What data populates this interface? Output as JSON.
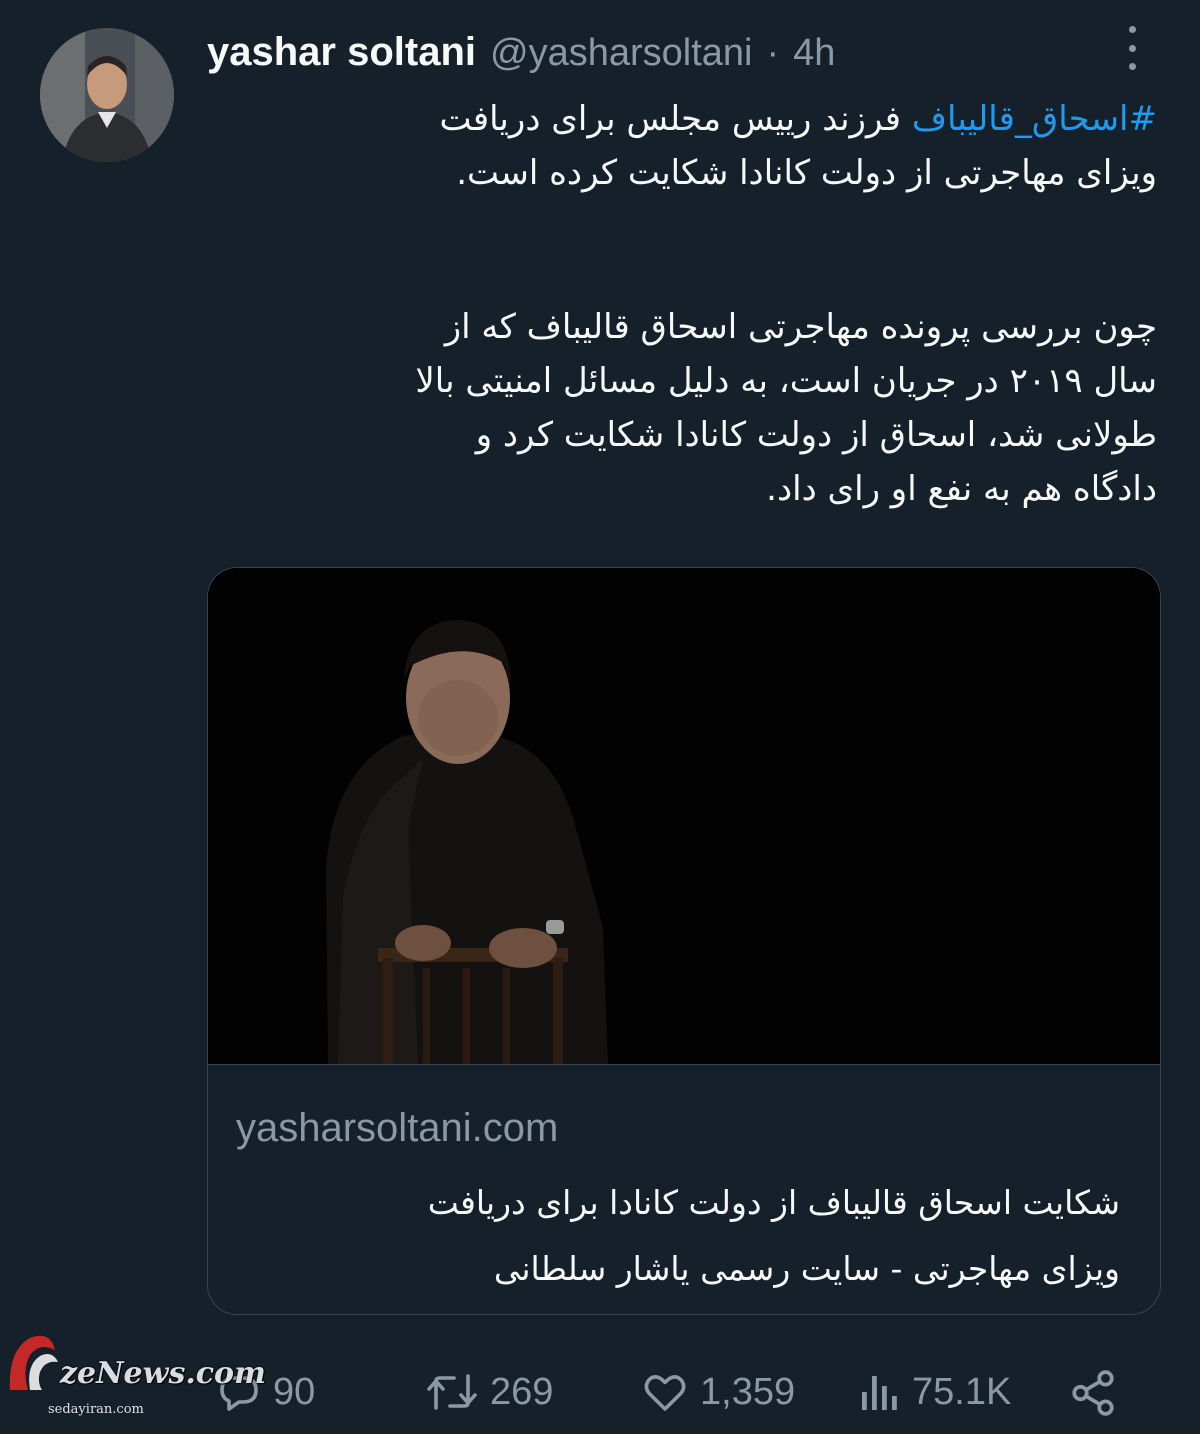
{
  "tweet": {
    "display_name": "yashar soltani",
    "handle": "@yasharsoltani",
    "separator": "·",
    "time": "4h",
    "hashtag": "#اسحاق_قالیباف",
    "para1_rest": " فرزند رییس مجلس برای دریافت",
    "para1_line2": "ویزای مهاجرتی از دولت کانادا شکایت کرده است.",
    "para2_lines": [
      "چون بررسی پرونده مهاجرتی اسحاق قالیباف که از",
      "سال ۲۰۱۹ در جریان است، به دلیل مسائل امنیتی بالا",
      "طولانی شد، اسحاق از دولت کانادا شکایت کرد و",
      "دادگاه هم به نفع او رای داد."
    ]
  },
  "card": {
    "domain": "yasharsoltani.com",
    "title_lines": [
      "شکایت اسحاق قالیباف از دولت کانادا برای دریافت",
      "ویزای مهاجرتی - سایت رسمی یاشار سلطانی"
    ]
  },
  "actions": {
    "replies": "90",
    "retweets": "269",
    "likes": "1,359",
    "views": "75.1K"
  },
  "watermark": {
    "text": "zeNews.com",
    "sub": "sedayiran.com"
  },
  "colors": {
    "background": "#15202b",
    "text": "#f7f9f9",
    "secondary": "#8b98a5",
    "accent": "#1d9bf0",
    "border": "#38444d"
  },
  "icons": [
    "more-icon",
    "reply-icon",
    "retweet-icon",
    "like-icon",
    "views-icon",
    "share-icon"
  ]
}
